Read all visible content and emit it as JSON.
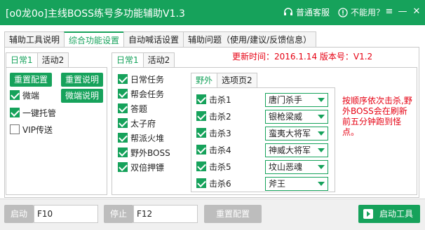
{
  "window": {
    "title": "[o0龙0o]主线BOSS练号多功能辅助V1.3",
    "support_label": "普通客服",
    "unavailable_label": "不能用？",
    "menu_glyph": "≡",
    "minimize_glyph": "—",
    "close_glyph": "✕"
  },
  "main_tabs": [
    "辅助工具说明",
    "综合功能设置",
    "自动喊话设置",
    "辅助问题（使用/建议/反馈信息）"
  ],
  "left_panel": {
    "tabs": [
      "日常1",
      "活动2"
    ],
    "reset_config": "重置配置",
    "reset_desc": "重置说明",
    "micro_desc": "微端说明",
    "checks": [
      {
        "label": "微端",
        "checked": true
      },
      {
        "label": "一键托管",
        "checked": true
      },
      {
        "label": "VIP传送",
        "checked": false
      }
    ]
  },
  "middle_panel": {
    "tabs": [
      "日常1",
      "活动2"
    ],
    "update_text": "更新时间：2016.1.14   版本号：V1.2",
    "checks": [
      {
        "label": "日常任务",
        "checked": true
      },
      {
        "label": "帮会任务",
        "checked": true
      },
      {
        "label": "答题",
        "checked": true
      },
      {
        "label": "太子府",
        "checked": true
      },
      {
        "label": "帮派火堆",
        "checked": true
      },
      {
        "label": "野外BOSS",
        "checked": true
      },
      {
        "label": "双倍押镖",
        "checked": true
      }
    ]
  },
  "boss_panel": {
    "tabs": [
      "野外",
      "选项页2"
    ],
    "rows": [
      {
        "label": "击杀1",
        "checked": true,
        "value": "唐门杀手"
      },
      {
        "label": "击杀2",
        "checked": true,
        "value": "银枪梁威"
      },
      {
        "label": "击杀3",
        "checked": true,
        "value": "蛮夷大将军"
      },
      {
        "label": "击杀4",
        "checked": true,
        "value": "神威大将军"
      },
      {
        "label": "击杀5",
        "checked": true,
        "value": "坟山恶魂"
      },
      {
        "label": "击杀6",
        "checked": true,
        "value": "斧王"
      }
    ],
    "notice": "按顺序依次击杀,野外BOSS会在刷新前五分钟跑到怪点。"
  },
  "bottom": {
    "start_label": "启动",
    "start_key": "F10",
    "stop_label": "停止",
    "stop_key": "F12",
    "reset_config": "重置配置",
    "launch_tool": "启动工具"
  },
  "colors": {
    "accent": "#16a25b",
    "warning": "#e60012"
  }
}
